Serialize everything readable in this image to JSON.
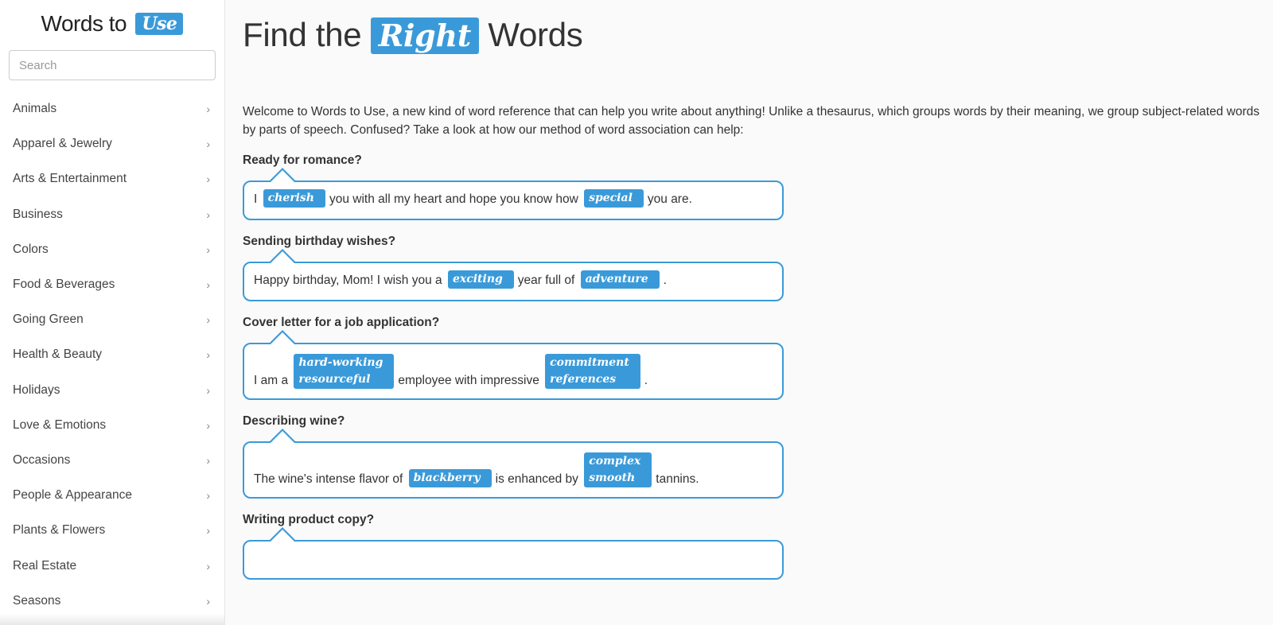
{
  "sidebar": {
    "logo": {
      "text": "Words to",
      "highlight": "Use"
    },
    "search": {
      "placeholder": "Search",
      "value": ""
    },
    "items": [
      {
        "label": "Animals"
      },
      {
        "label": "Apparel & Jewelry"
      },
      {
        "label": "Arts & Entertainment"
      },
      {
        "label": "Business"
      },
      {
        "label": "Colors"
      },
      {
        "label": "Food & Beverages"
      },
      {
        "label": "Going Green"
      },
      {
        "label": "Health & Beauty"
      },
      {
        "label": "Holidays"
      },
      {
        "label": "Love & Emotions"
      },
      {
        "label": "Occasions"
      },
      {
        "label": "People & Appearance"
      },
      {
        "label": "Plants & Flowers"
      },
      {
        "label": "Real Estate"
      },
      {
        "label": "Seasons"
      }
    ],
    "chevron_icon": "›"
  },
  "main": {
    "headline": {
      "before": "Find the ",
      "highlight": "Right",
      "after": " Words"
    },
    "intro": "Welcome to Words to Use, a new kind of word reference that can help you write about anything! Unlike a thesaurus, which groups words by their meaning, we group subject-related words by parts of speech. Confused? Take a look at how our method of word association can help:",
    "examples": [
      {
        "question": "Ready for romance?",
        "parts": [
          {
            "text": "I "
          },
          {
            "tags": [
              "cherish"
            ]
          },
          {
            "text": "you with all my heart and hope you know how "
          },
          {
            "tags": [
              "special"
            ]
          },
          {
            "text": "you are."
          }
        ]
      },
      {
        "question": "Sending birthday wishes?",
        "parts": [
          {
            "text": "Happy birthday, Mom! I wish you a "
          },
          {
            "tags": [
              "exciting"
            ]
          },
          {
            "text": "year full of "
          },
          {
            "tags": [
              "adventure"
            ]
          },
          {
            "text": "."
          }
        ]
      },
      {
        "question": "Cover letter for a job application?",
        "parts": [
          {
            "text": "I am a "
          },
          {
            "tags": [
              "hard-working",
              "resourceful"
            ]
          },
          {
            "text": "employee with impressive "
          },
          {
            "tags": [
              "commitment",
              "references"
            ]
          },
          {
            "text": "."
          }
        ]
      },
      {
        "question": "Describing wine?",
        "parts": [
          {
            "text": "The wine's intense flavor of "
          },
          {
            "tags": [
              "blackberry"
            ]
          },
          {
            "text": "is enhanced by "
          },
          {
            "tags": [
              "complex",
              "smooth"
            ]
          },
          {
            "text": "tannins."
          }
        ]
      },
      {
        "question": "Writing product copy?",
        "parts": []
      }
    ]
  },
  "colors": {
    "accent": "#3a9ad9",
    "text": "#333333",
    "background": "#fafafa"
  }
}
